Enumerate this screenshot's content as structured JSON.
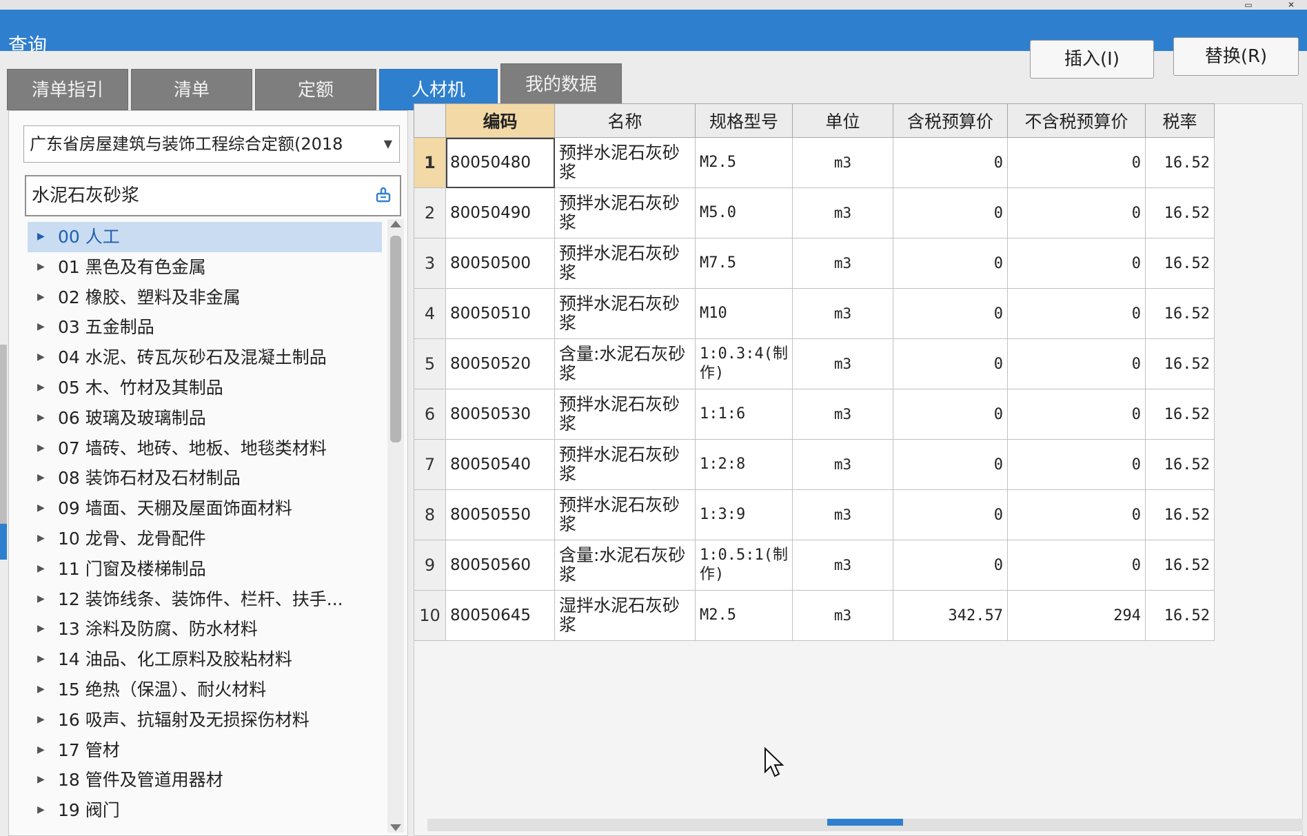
{
  "window": {
    "title": "查询"
  },
  "tabs": [
    {
      "label": "清单指引",
      "active": false
    },
    {
      "label": "清单",
      "active": false
    },
    {
      "label": "定额",
      "active": false
    },
    {
      "label": "人材机",
      "active": true
    },
    {
      "label": "我的数据",
      "active": false
    }
  ],
  "actions": {
    "insert_label": "插入(I)",
    "replace_label": "替换(R)"
  },
  "left": {
    "library_select": "广东省房屋建筑与装饰工程综合定额(2018",
    "search_value": "水泥石灰砂浆",
    "tree": [
      {
        "label": "00 人工",
        "selected": true
      },
      {
        "label": "01 黑色及有色金属"
      },
      {
        "label": "02 橡胶、塑料及非金属"
      },
      {
        "label": "03 五金制品"
      },
      {
        "label": "04 水泥、砖瓦灰砂石及混凝土制品"
      },
      {
        "label": "05 木、竹材及其制品"
      },
      {
        "label": "06 玻璃及玻璃制品"
      },
      {
        "label": "07 墙砖、地砖、地板、地毯类材料"
      },
      {
        "label": "08 装饰石材及石材制品"
      },
      {
        "label": "09 墙面、天棚及屋面饰面材料"
      },
      {
        "label": "10 龙骨、龙骨配件"
      },
      {
        "label": "11 门窗及楼梯制品"
      },
      {
        "label": "12 装饰线条、装饰件、栏杆、扶手..."
      },
      {
        "label": "13 涂料及防腐、防水材料"
      },
      {
        "label": "14 油品、化工原料及胶粘材料"
      },
      {
        "label": "15 绝热（保温）、耐火材料"
      },
      {
        "label": "16 吸声、抗辐射及无损探伤材料"
      },
      {
        "label": "17 管材"
      },
      {
        "label": "18 管件及管道用器材"
      },
      {
        "label": "19 阀门"
      }
    ]
  },
  "table": {
    "headers": [
      "",
      "编码",
      "名称",
      "规格型号",
      "单位",
      "含税预算价",
      "不含税预算价",
      "税率"
    ],
    "rows": [
      [
        "1",
        "80050480",
        "预拌水泥石灰砂浆",
        "M2.5",
        "m3",
        "0",
        "0",
        "16.52"
      ],
      [
        "2",
        "80050490",
        "预拌水泥石灰砂浆",
        "M5.0",
        "m3",
        "0",
        "0",
        "16.52"
      ],
      [
        "3",
        "80050500",
        "预拌水泥石灰砂浆",
        "M7.5",
        "m3",
        "0",
        "0",
        "16.52"
      ],
      [
        "4",
        "80050510",
        "预拌水泥石灰砂浆",
        "M10",
        "m3",
        "0",
        "0",
        "16.52"
      ],
      [
        "5",
        "80050520",
        "含量:水泥石灰砂浆",
        "1:0.3:4(制作)",
        "m3",
        "0",
        "0",
        "16.52"
      ],
      [
        "6",
        "80050530",
        "预拌水泥石灰砂浆",
        "1:1:6",
        "m3",
        "0",
        "0",
        "16.52"
      ],
      [
        "7",
        "80050540",
        "预拌水泥石灰砂浆",
        "1:2:8",
        "m3",
        "0",
        "0",
        "16.52"
      ],
      [
        "8",
        "80050550",
        "预拌水泥石灰砂浆",
        "1:3:9",
        "m3",
        "0",
        "0",
        "16.52"
      ],
      [
        "9",
        "80050560",
        "含量:水泥石灰砂浆",
        "1:0.5:1(制作)",
        "m3",
        "0",
        "0",
        "16.52"
      ],
      [
        "10",
        "80050645",
        "湿拌水泥石灰砂浆",
        "M2.5",
        "m3",
        "342.57",
        "294",
        "16.52"
      ]
    ]
  },
  "colors": {
    "accent": "#2f7fcf",
    "selected_header": "#f2d9a6",
    "tab_inactive": "#7e7e7e"
  }
}
